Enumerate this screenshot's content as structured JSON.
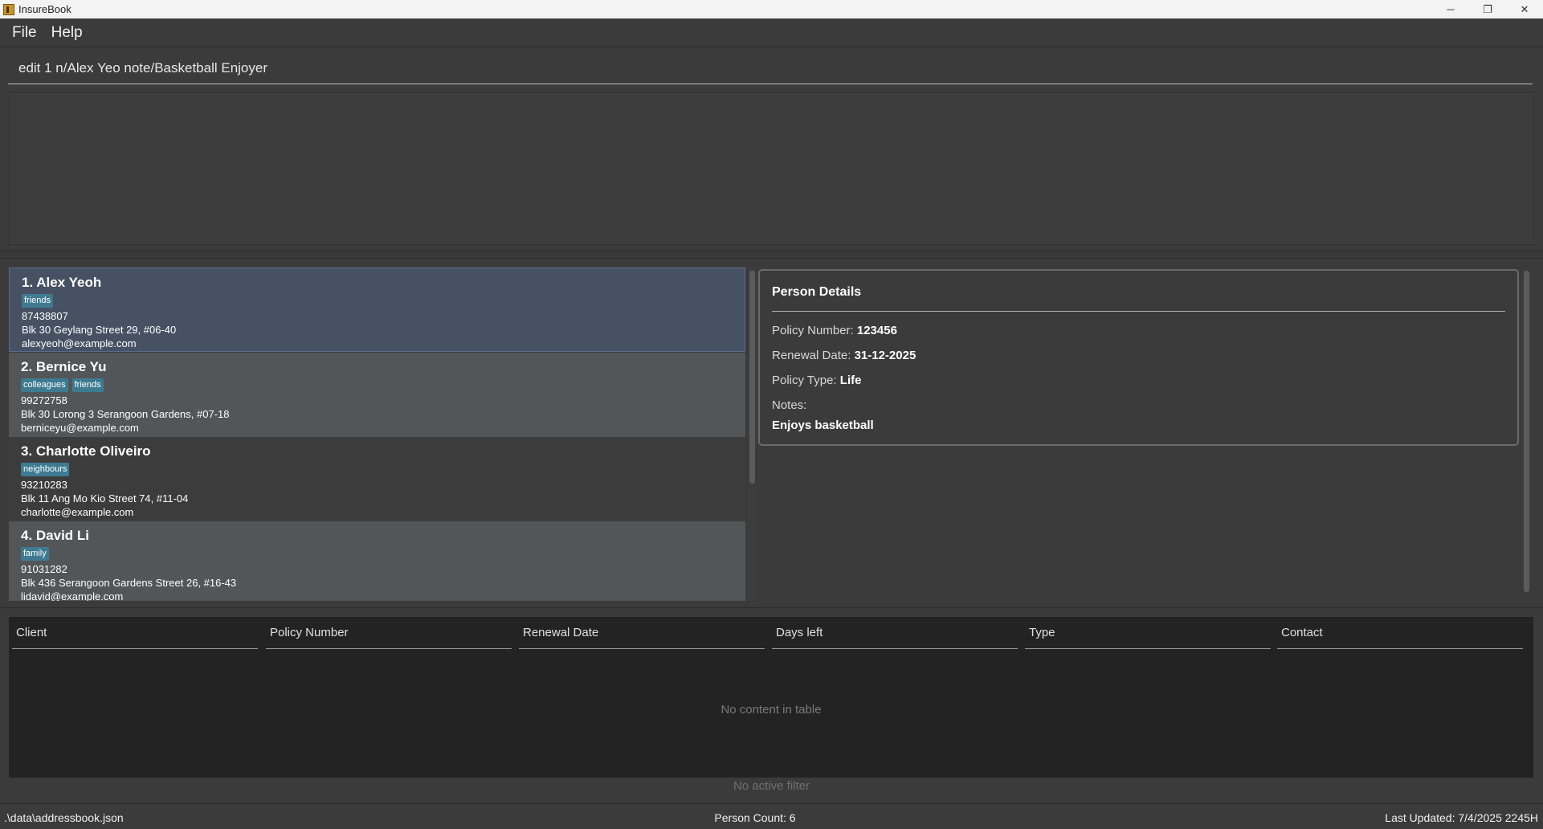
{
  "window": {
    "title": "InsureBook",
    "minimize": "─",
    "restore": "❐",
    "close": "✕"
  },
  "menu": {
    "file": "File",
    "help": "Help"
  },
  "command": {
    "value": "edit 1 n/Alex Yeo note/Basketball Enjoyer"
  },
  "persons": [
    {
      "name": "1. Alex Yeoh",
      "tags": [
        "friends"
      ],
      "phone": "87438807",
      "address": "Blk 30 Geylang Street 29, #06-40",
      "email": "alexyeoh@example.com"
    },
    {
      "name": "2. Bernice Yu",
      "tags": [
        "colleagues",
        "friends"
      ],
      "phone": "99272758",
      "address": "Blk 30 Lorong 3 Serangoon Gardens, #07-18",
      "email": "berniceyu@example.com"
    },
    {
      "name": "3. Charlotte Oliveiro",
      "tags": [
        "neighbours"
      ],
      "phone": "93210283",
      "address": "Blk 11 Ang Mo Kio Street 74, #11-04",
      "email": "charlotte@example.com"
    },
    {
      "name": "4. David Li",
      "tags": [
        "family"
      ],
      "phone": "91031282",
      "address": "Blk 436 Serangoon Gardens Street 26, #16-43",
      "email": "lidavid@example.com"
    }
  ],
  "details": {
    "title": "Person Details",
    "policy_number_label": "Policy Number:",
    "policy_number": "123456",
    "renewal_date_label": "Renewal Date:",
    "renewal_date": "31-12-2025",
    "policy_type_label": "Policy Type:",
    "policy_type": "Life",
    "notes_label": "Notes:",
    "notes": "Enjoys basketball"
  },
  "table": {
    "columns": [
      "Client",
      "Policy Number",
      "Renewal Date",
      "Days left",
      "Type",
      "Contact"
    ],
    "empty_message": "No content in table",
    "filter_status": "No active filter"
  },
  "status": {
    "path": ".\\data\\addressbook.json",
    "count": "Person Count: 6",
    "updated": "Last Updated: 7/4/2025 2245H"
  },
  "colors": {
    "background": "#3b3b3b",
    "selected_card": "#465163",
    "tag": "#3e7b91",
    "table_bg": "#232323"
  }
}
